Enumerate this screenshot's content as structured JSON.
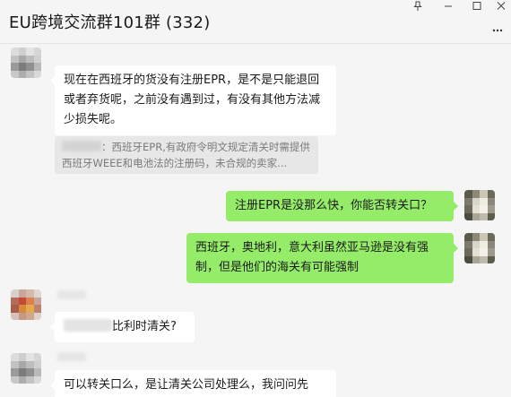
{
  "window": {
    "title": "EU跨境交流群101群 (332)",
    "controls": [
      "pin-icon",
      "minimize-icon",
      "maximize-icon",
      "close-icon"
    ],
    "more_icon": "more-dots-icon"
  },
  "messages": [
    {
      "direction": "incoming",
      "text": "现在在西班牙的货没有注册EPR，是不是只能退回或者弃货呢，之前没有遇到过，有没有其他方法减少损失呢。"
    },
    {
      "direction": "quote",
      "text": "：西班牙EPR,有政府令明文规定清关时需提供西班牙WEEE和电池法的注册码，未合规的卖家..."
    },
    {
      "direction": "outgoing",
      "text": "注册EPR是没那么快，你能否转关口？"
    },
    {
      "direction": "outgoing",
      "text": "西班牙，奥地利，意大利虽然亚马逊是没有强制，但是他们的海关有可能强制"
    },
    {
      "direction": "incoming",
      "text": "比利时清关?"
    },
    {
      "direction": "incoming",
      "text": "可以转关口么，是让清关公司处理么，我问问先"
    }
  ],
  "colors": {
    "outgoing_bubble": "#95ec69",
    "incoming_bubble": "#ffffff",
    "background": "#f5f5f5",
    "quote_bg": "#e7e7e7"
  }
}
